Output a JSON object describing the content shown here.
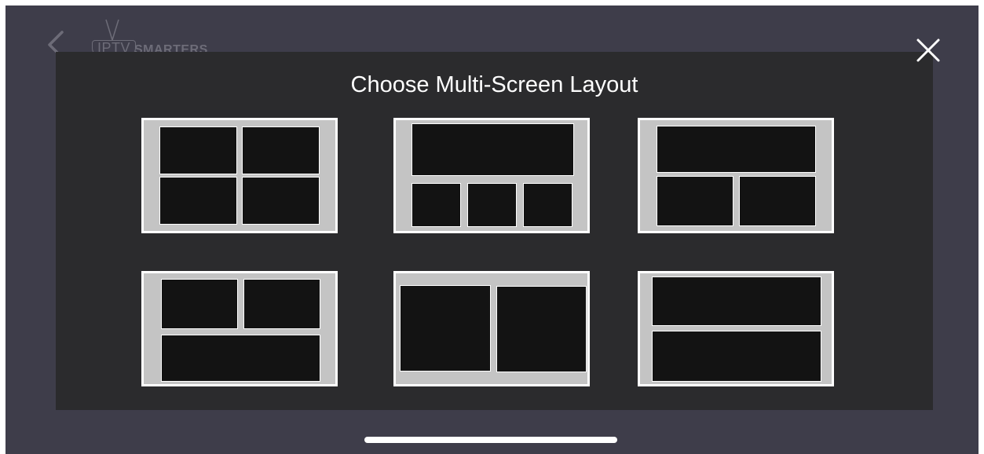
{
  "header": {
    "logo_iptv": "IPTV",
    "logo_smarters": "SMARTERS",
    "back_icon": "chevron-left-icon",
    "close_icon": "close-icon"
  },
  "modal": {
    "title": "Choose Multi-Screen Layout"
  },
  "layouts": [
    {
      "name": "layout-four-grid"
    },
    {
      "name": "layout-one-top-three-bottom"
    },
    {
      "name": "layout-one-top-two-bottom"
    },
    {
      "name": "layout-two-top-one-bottom"
    },
    {
      "name": "layout-two-side-by-side"
    },
    {
      "name": "layout-two-stacked"
    }
  ],
  "colors": {
    "background": "#3e3d4a",
    "modal": "#2b2b2d",
    "tile_frame": "#c4c4c4",
    "pane": "#131313"
  }
}
